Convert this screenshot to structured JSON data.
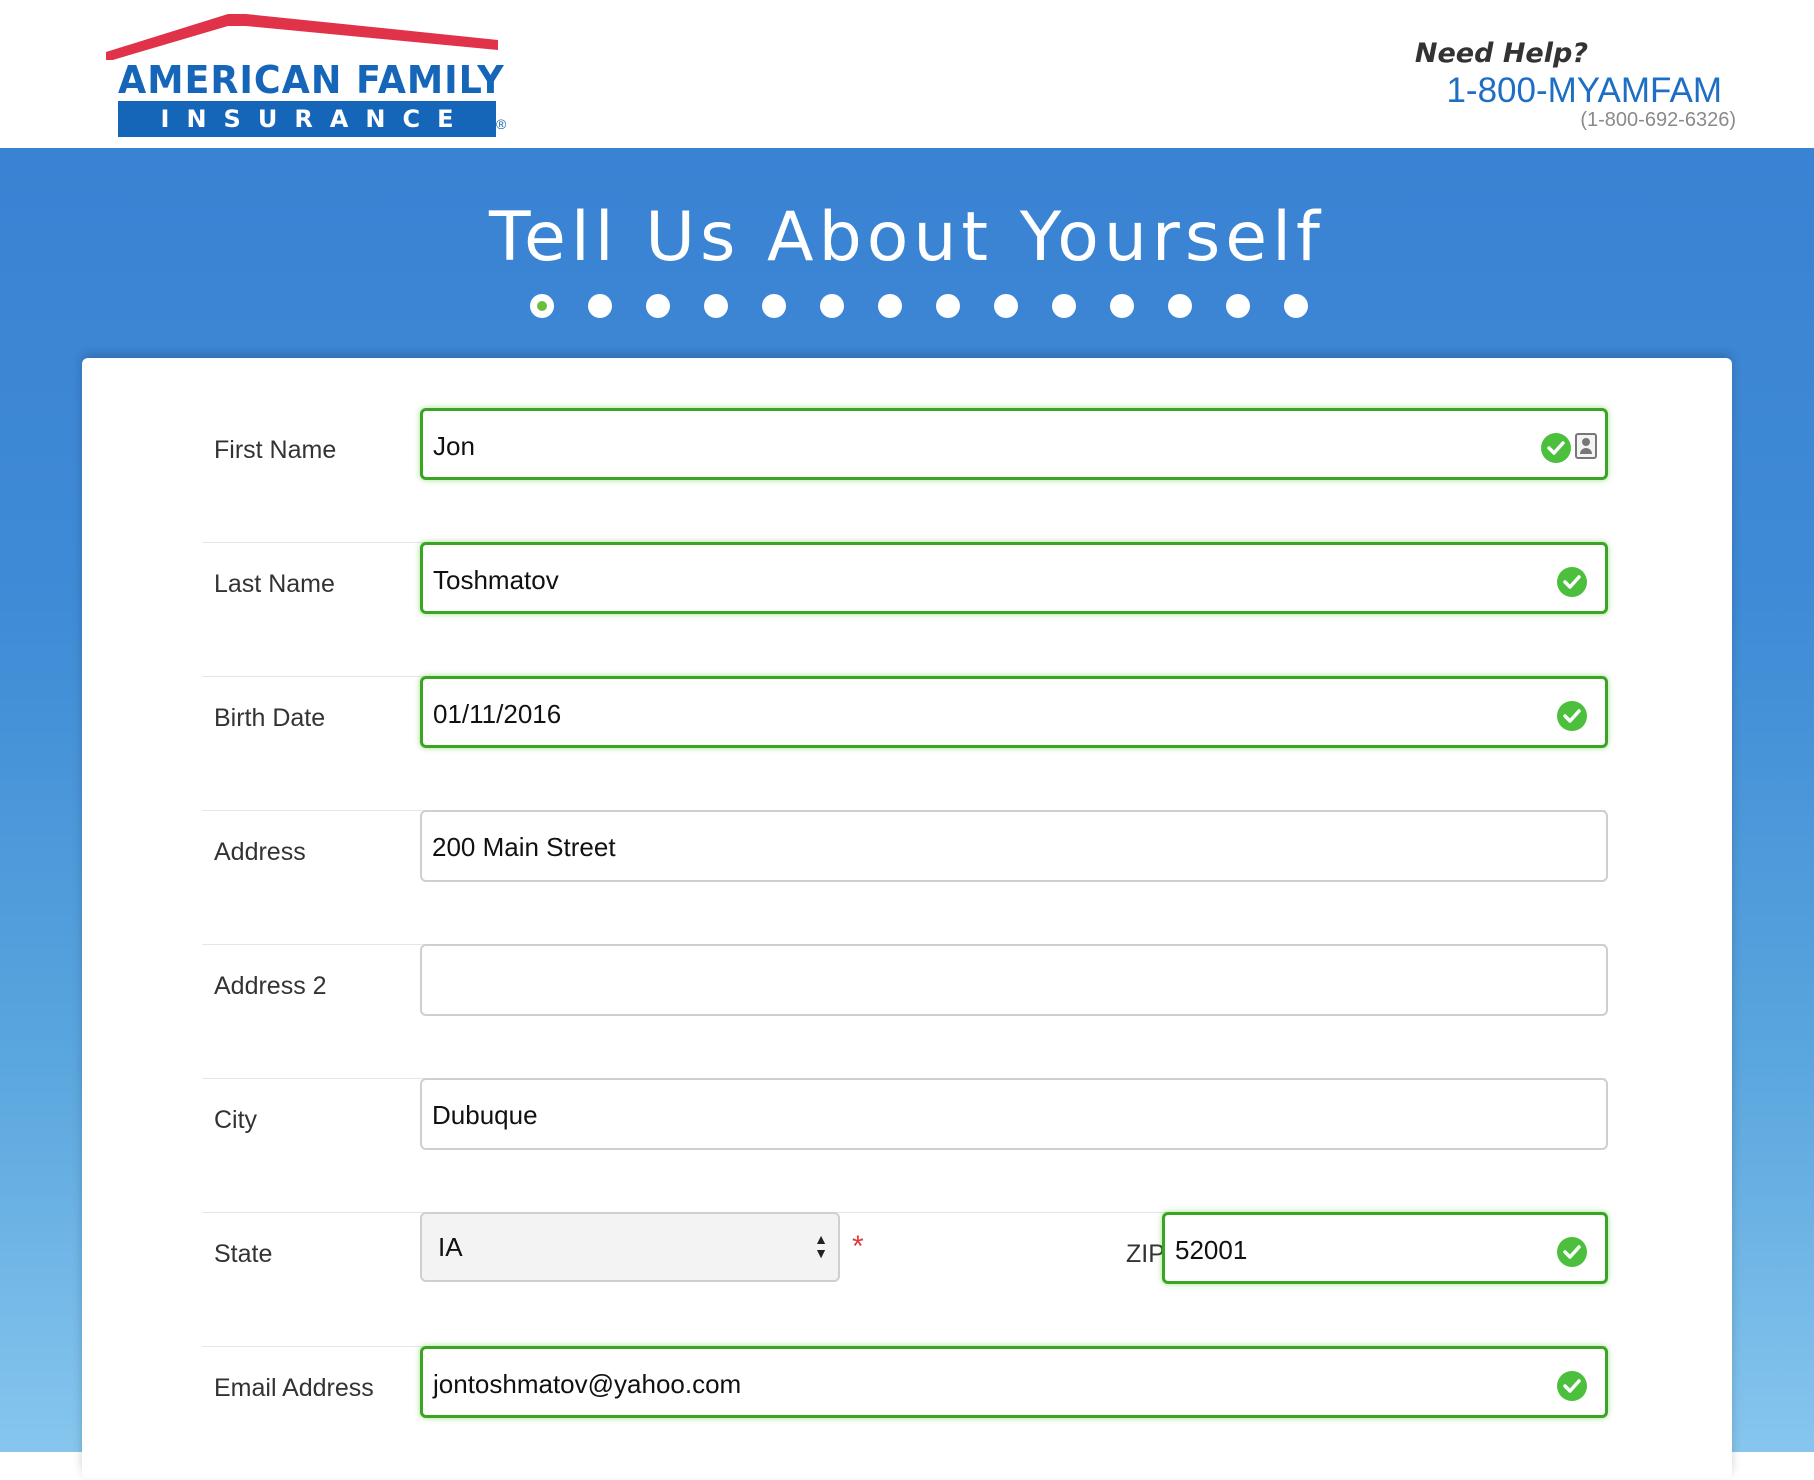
{
  "brand": {
    "word_top": "AMERICAN FAMILY",
    "word_bottom": "INSURANCE",
    "registered": "®",
    "primary_color": "#1565b8",
    "roof_color": "#e0334a"
  },
  "help": {
    "title": "Need Help?",
    "phone_vanity": "1-800-MYAMFAM",
    "phone_digits": "(1-800-692-6326)"
  },
  "hero": {
    "title": "Tell Us About Yourself",
    "steps_total": 14,
    "current_step": 1
  },
  "form": {
    "first_name": {
      "label": "First Name",
      "value": "Jon",
      "valid": true
    },
    "last_name": {
      "label": "Last Name",
      "value": "Toshmatov",
      "valid": true
    },
    "birth_date": {
      "label": "Birth Date",
      "value": "01/11/2016",
      "valid": true
    },
    "address": {
      "label": "Address",
      "value": "200 Main Street"
    },
    "address2": {
      "label": "Address 2",
      "value": ""
    },
    "city": {
      "label": "City",
      "value": "Dubuque"
    },
    "state": {
      "label": "State",
      "value": "IA",
      "required_mark": "*"
    },
    "zip": {
      "label": "ZIP Code",
      "value": "52001",
      "valid": true
    },
    "email": {
      "label": "Email Address",
      "value": "jontoshmatov@yahoo.com",
      "valid": true
    }
  },
  "colors": {
    "valid_border": "#3aa524",
    "check_green": "#4cbf3d",
    "hero_blue": "#3a82d3",
    "required_red": "#e03b3b"
  },
  "icons": [
    "check-icon",
    "contact-card-icon",
    "select-arrows-icon",
    "step-dot"
  ]
}
